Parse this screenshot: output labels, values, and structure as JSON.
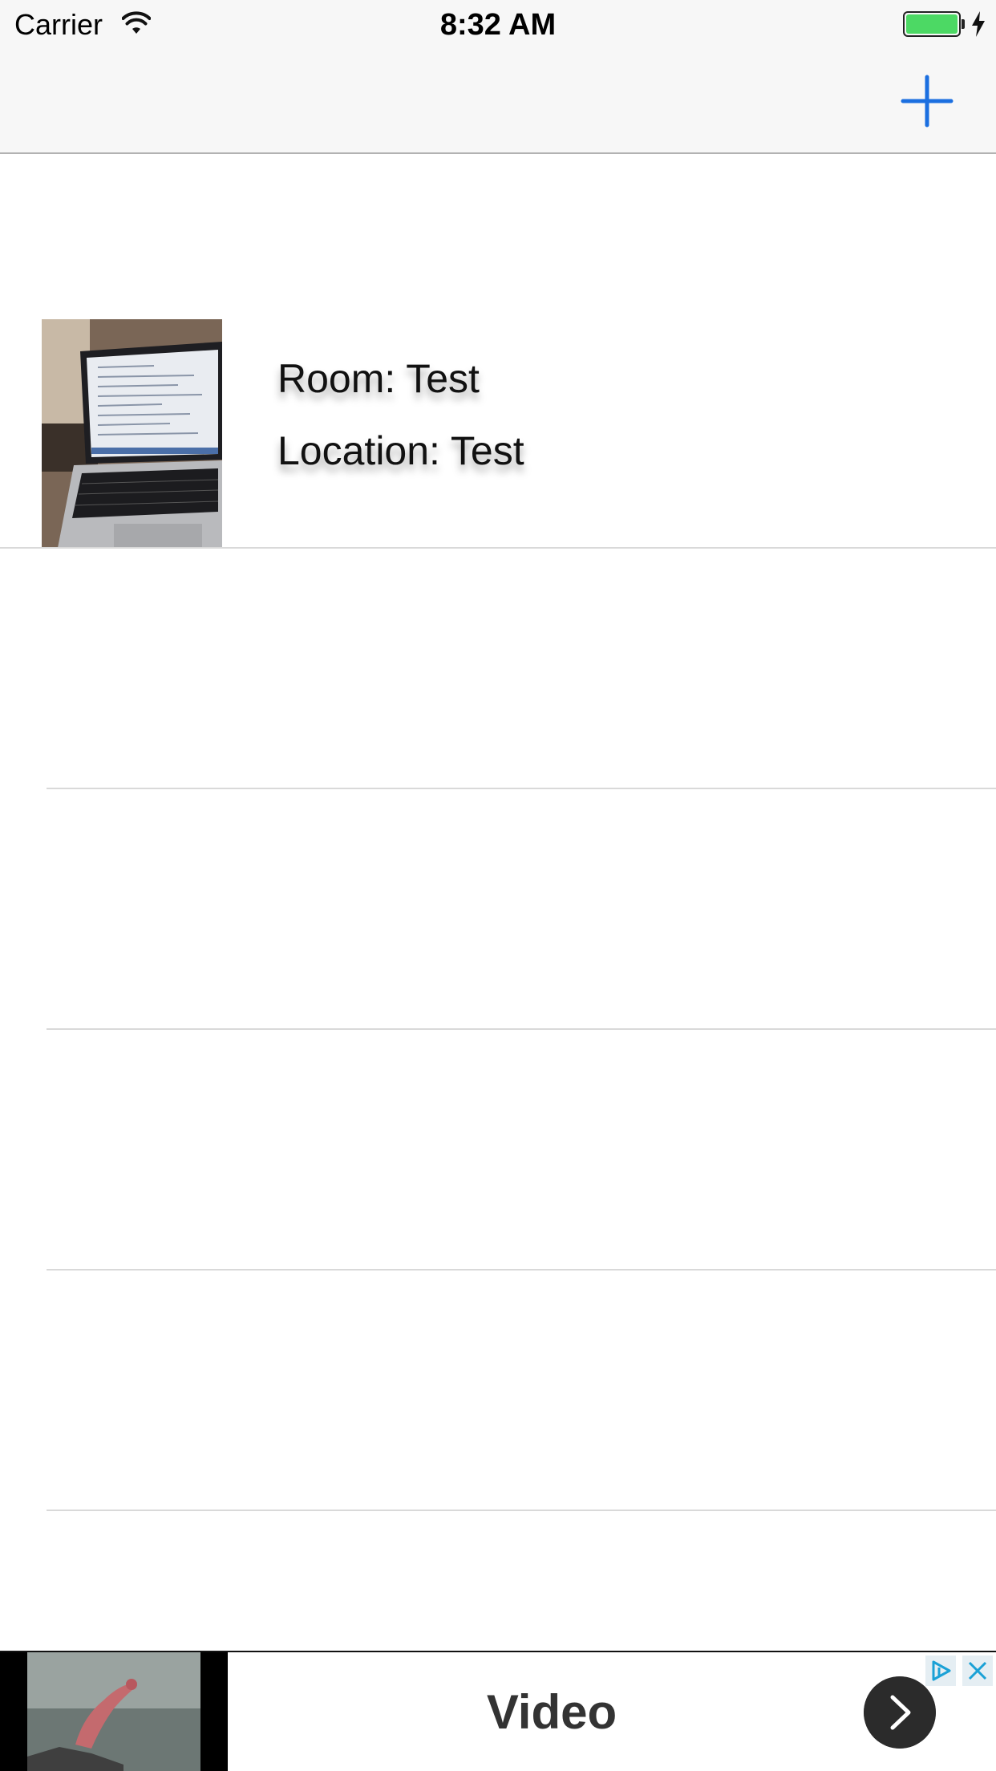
{
  "status_bar": {
    "carrier": "Carrier",
    "time": "8:32 AM",
    "battery_color": "#4cd964"
  },
  "nav_bar": {
    "add_icon": "plus-icon",
    "accent": "#1b6fe0"
  },
  "table": {
    "items": [
      {
        "room": "Room: Test",
        "location": "Location: Test",
        "thumbnail": "laptop-photo"
      }
    ],
    "empty_rows": 4
  },
  "ad": {
    "title": "Video",
    "image": "diver-photo",
    "icons": [
      "ad-choices-icon",
      "close-icon",
      "chevron-right-icon"
    ],
    "accent": "#1aa1d6"
  }
}
